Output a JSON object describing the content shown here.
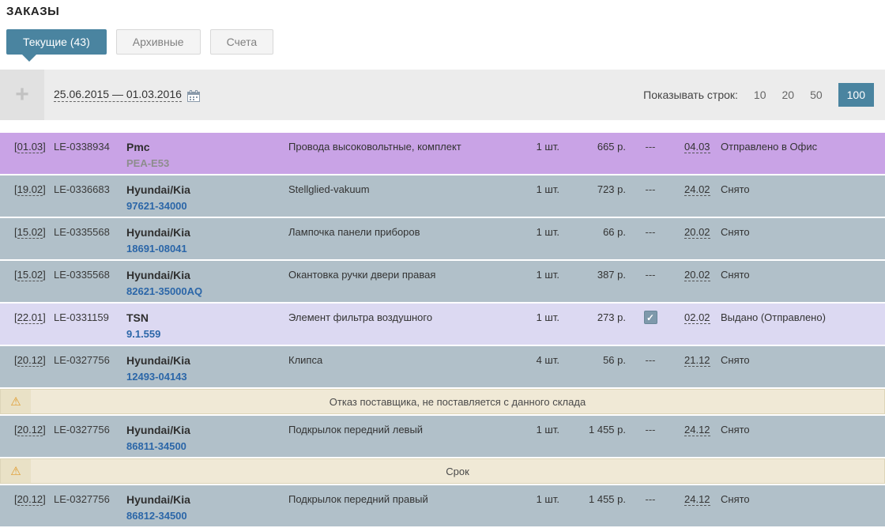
{
  "page": {
    "title": "ЗАКАЗЫ"
  },
  "tabs": [
    {
      "label": "Текущие (43)",
      "active": true
    },
    {
      "label": "Архивные",
      "active": false
    },
    {
      "label": "Счета",
      "active": false
    }
  ],
  "filter": {
    "add_label": "+",
    "date_range": "25.06.2015 — 01.03.2016",
    "rows_label": "Показывать строк:",
    "rows_options": [
      "10",
      "20",
      "50",
      "100"
    ],
    "rows_selected": "100"
  },
  "symbols": {
    "bracket_open": "[",
    "bracket_close": "]",
    "check": "✓",
    "warning": "⚠"
  },
  "colors": {
    "accent_teal": "#4a84a0",
    "row_purple": "#c9a3e6",
    "row_gray_blue": "#b1c0c9",
    "row_lavender": "#dcd9f2",
    "row_warning": "#f0e9d6",
    "link_blue": "#2b66a8",
    "warning_icon": "#e09b2d"
  },
  "table": {
    "rows": [
      {
        "type": "order",
        "date": "01.03",
        "order_no": "LE-0338934",
        "brand": "Pmc",
        "article": "PEA-E53",
        "desc": "Провода высоковольтные, комплект",
        "qty": "1 шт.",
        "price": "665 р.",
        "flag": "---",
        "ship_date": "04.03",
        "status": "Отправлено в Офис"
      },
      {
        "type": "order",
        "date": "19.02",
        "order_no": "LE-0336683",
        "brand": "Hyundai/Kia",
        "article": "97621-34000",
        "desc": "Stellglied-vakuum",
        "qty": "1 шт.",
        "price": "723 р.",
        "flag": "---",
        "ship_date": "24.02",
        "status": "Снято"
      },
      {
        "type": "order",
        "date": "15.02",
        "order_no": "LE-0335568",
        "brand": "Hyundai/Kia",
        "article": "18691-08041",
        "desc": "Лампочка панели приборов",
        "qty": "1 шт.",
        "price": "66 р.",
        "flag": "---",
        "ship_date": "20.02",
        "status": "Снято"
      },
      {
        "type": "order",
        "date": "15.02",
        "order_no": "LE-0335568",
        "brand": "Hyundai/Kia",
        "article": "82621-35000AQ",
        "desc": "Окантовка ручки двери правая",
        "qty": "1 шт.",
        "price": "387 р.",
        "flag": "---",
        "ship_date": "20.02",
        "status": "Снято"
      },
      {
        "type": "order",
        "date": "22.01",
        "order_no": "LE-0331159",
        "brand": "TSN",
        "article": "9.1.559",
        "desc": "Элемент фильтра воздушного",
        "qty": "1 шт.",
        "price": "273 р.",
        "flag": "checkbox_checked",
        "ship_date": "02.02",
        "status": "Выдано (Отправлено)"
      },
      {
        "type": "order",
        "date": "20.12",
        "order_no": "LE-0327756",
        "brand": "Hyundai/Kia",
        "article": "12493-04143",
        "desc": "Клипса",
        "qty": "4 шт.",
        "price": "56 р.",
        "flag": "---",
        "ship_date": "21.12",
        "status": "Снято"
      },
      {
        "type": "warning",
        "text": "Отказ поставщика, не поставляется с данного склада"
      },
      {
        "type": "order",
        "date": "20.12",
        "order_no": "LE-0327756",
        "brand": "Hyundai/Kia",
        "article": "86811-34500",
        "desc": "Подкрылок передний левый",
        "qty": "1 шт.",
        "price": "1 455 р.",
        "flag": "---",
        "ship_date": "24.12",
        "status": "Снято"
      },
      {
        "type": "warning",
        "text": "Срок"
      },
      {
        "type": "order",
        "date": "20.12",
        "order_no": "LE-0327756",
        "brand": "Hyundai/Kia",
        "article": "86812-34500",
        "desc": "Подкрылок передний правый",
        "qty": "1 шт.",
        "price": "1 455 р.",
        "flag": "---",
        "ship_date": "24.12",
        "status": "Снято"
      }
    ]
  }
}
